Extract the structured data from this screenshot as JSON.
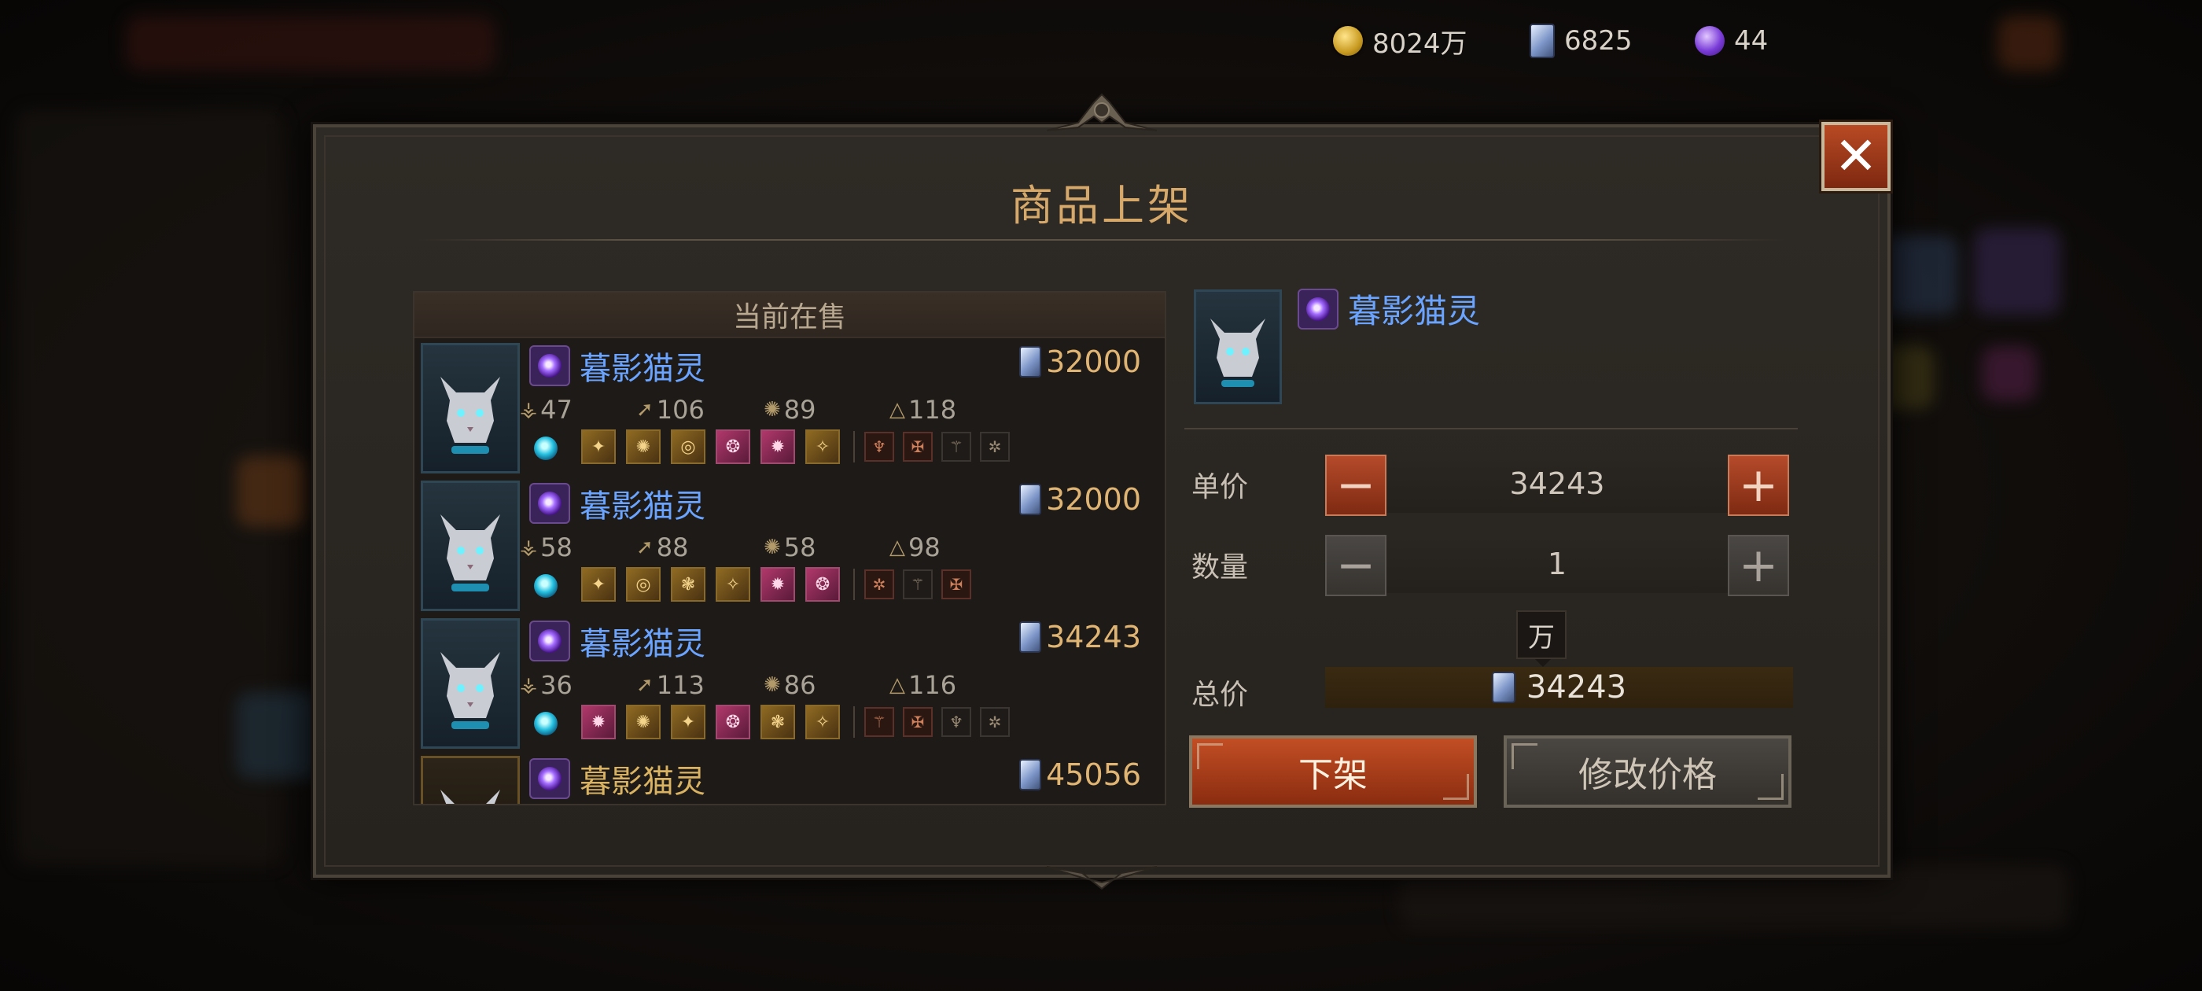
{
  "currency": {
    "gold": "8024万",
    "crystal": "6825",
    "orb": "44"
  },
  "dialog": {
    "title": "商品上架",
    "close_label": "✕"
  },
  "listing": {
    "header": "当前在售",
    "items": [
      {
        "name": "暮影猫灵",
        "price": "32000",
        "stats": [
          "47",
          "106",
          "89",
          "118"
        ]
      },
      {
        "name": "暮影猫灵",
        "price": "32000",
        "stats": [
          "58",
          "88",
          "58",
          "98"
        ]
      },
      {
        "name": "暮影猫灵",
        "price": "34243",
        "stats": [
          "36",
          "113",
          "86",
          "116"
        ]
      },
      {
        "name": "暮影猫灵",
        "price": "45056"
      }
    ]
  },
  "detail": {
    "name": "暮影猫灵",
    "unit_price_label": "单价",
    "unit_price": "34243",
    "quantity_label": "数量",
    "quantity": "1",
    "unit_tip": "万",
    "total_label": "总价",
    "total": "34243",
    "delist_button": "下架",
    "modify_button": "修改价格"
  },
  "colors": {
    "title": "#d6a86a",
    "pet_name": "#6aa4ff",
    "price": "#e0b473",
    "action_red": "#c24e24"
  }
}
